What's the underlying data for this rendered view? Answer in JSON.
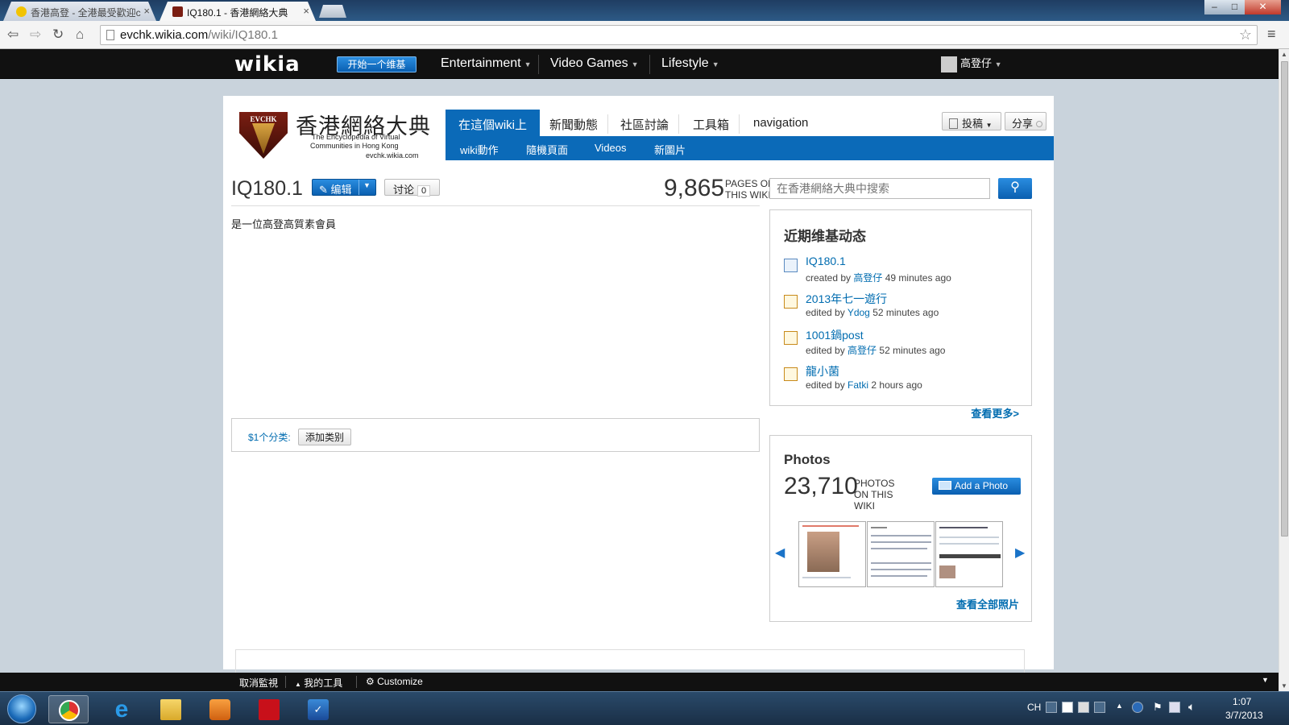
{
  "browser": {
    "tabs": [
      {
        "label": "香港高登 - 全港最受歡迎c"
      },
      {
        "label": "IQ180.1 - 香港網絡大典"
      }
    ],
    "url_host": "evchk.wikia.com",
    "url_path": "/wiki/IQ180.1"
  },
  "globalnav": {
    "logo": "wikia",
    "start_wiki": "开始一个维基",
    "hubs": [
      "Entertainment",
      "Video Games",
      "Lifestyle"
    ],
    "user": "高登仔"
  },
  "wiki": {
    "name": "香港網絡大典",
    "logo_badge": "EVCHK",
    "subtitle_line1": "The Encyclopedia of Virtual",
    "subtitle_line2": "Communities in Hong Kong",
    "domain": "evchk.wikia.com",
    "tabs": [
      "在這個wiki上",
      "新聞動態",
      "社區討論",
      "工具箱",
      "navigation"
    ],
    "subnav": [
      "wiki動作",
      "隨機頁面",
      "Videos",
      "新圖片"
    ],
    "contribute": "投稿",
    "share": "分享"
  },
  "article": {
    "title": "IQ180.1",
    "edit_label": "编辑",
    "talk_label": "讨论",
    "talk_count": "0",
    "body": "是一位高登高質素會員",
    "category_label": "$1个分类:",
    "add_category": "添加类别"
  },
  "stats": {
    "page_count": "9,865",
    "page_count_label_1": "PAGES ON",
    "page_count_label_2": "THIS WIKI"
  },
  "search": {
    "placeholder": "在香港網絡大典中搜索"
  },
  "activity": {
    "title": "近期维基动态",
    "items": [
      {
        "title": "IQ180.1",
        "action": "created by",
        "user": "高登仔",
        "time": "49 minutes ago",
        "icon": "new-page-icon"
      },
      {
        "title": "2013年七一遊行",
        "action": "edited by",
        "user": "Ydog",
        "time": "52 minutes ago",
        "icon": "edit-icon"
      },
      {
        "title": "1001鍋post",
        "action": "edited by",
        "user": "高登仔",
        "time": "52 minutes ago",
        "icon": "edit-icon"
      },
      {
        "title": "龍小菌",
        "action": "edited by",
        "user": "Fatki",
        "time": "2 hours ago",
        "icon": "edit-icon"
      }
    ],
    "more": "查看更多>"
  },
  "photos": {
    "title": "Photos",
    "count": "23,710",
    "label_1": "PHOTOS",
    "label_2": "ON THIS",
    "label_3": "WIKI",
    "add_photo": "Add a Photo",
    "view_all": "查看全部照片"
  },
  "wikia_toolbar": {
    "unwatch": "取消監視",
    "my_tools": "我的工具",
    "customize": "Customize"
  },
  "taskbar": {
    "lang": "CH",
    "time": "1:07",
    "date": "3/7/2013"
  },
  "colors": {
    "wikia_blue": "#0b6ab8",
    "link": "#006cb0",
    "global_nav": "#111111"
  }
}
